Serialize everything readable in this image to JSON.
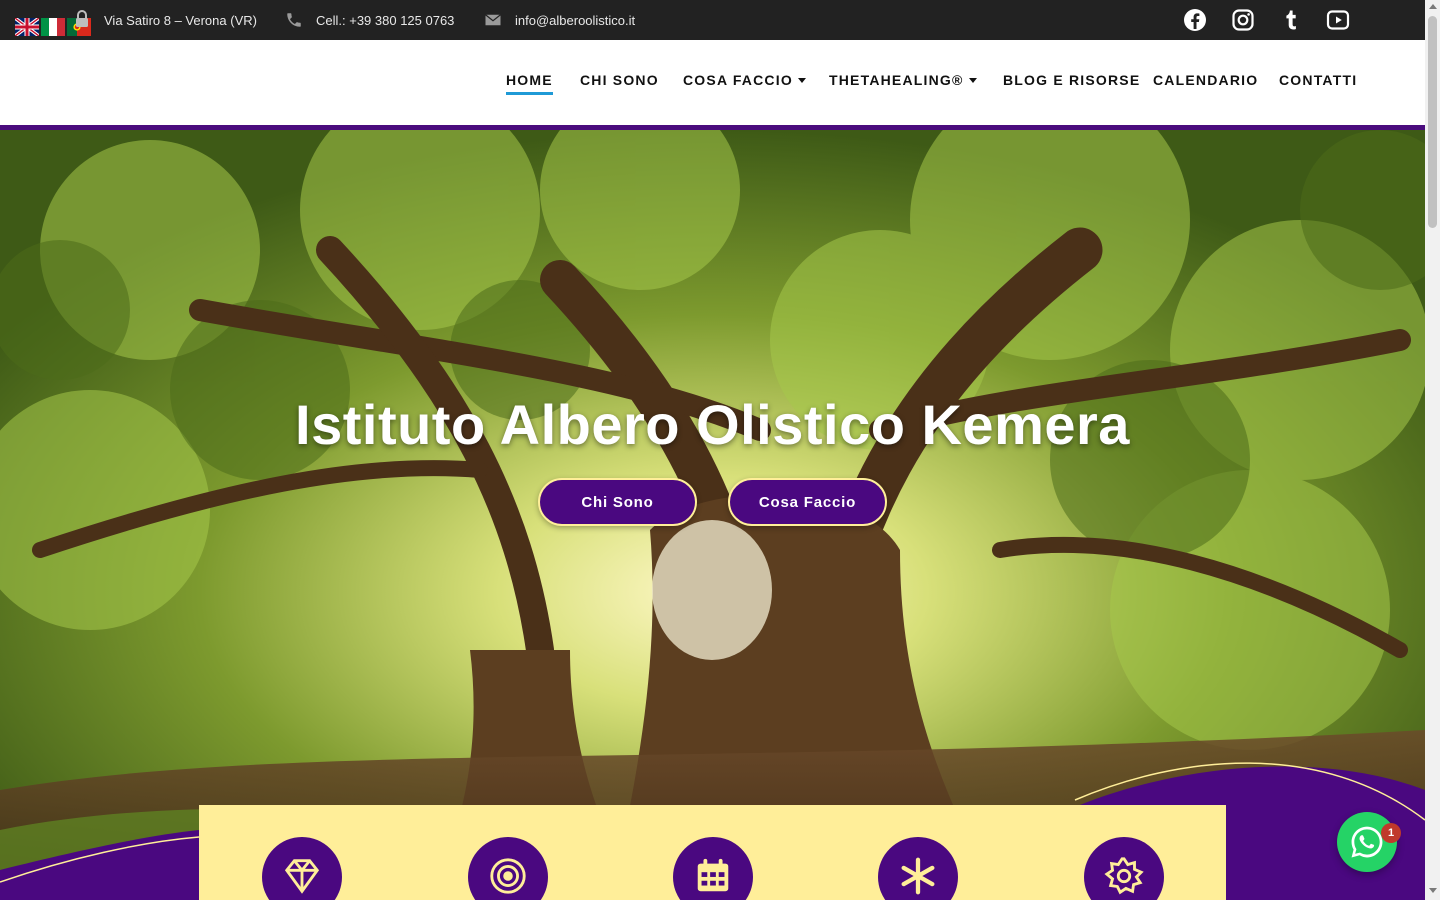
{
  "topbar": {
    "languages": [
      "English",
      "Italiano",
      "Português"
    ],
    "address": "Via Satiro 8 – Verona (VR)",
    "phone": "Cell.: +39 380 125 0763",
    "email": "info@alberoolistico.it",
    "social_icons": [
      "facebook-icon",
      "instagram-icon",
      "tumblr-icon",
      "youtube-icon"
    ]
  },
  "nav": {
    "items": [
      {
        "label": "HOME",
        "active": true,
        "dropdown": false
      },
      {
        "label": "CHI SONO",
        "active": false,
        "dropdown": false
      },
      {
        "label": "COSA FACCIO",
        "active": false,
        "dropdown": true
      },
      {
        "label": "THETAHEALING®",
        "active": false,
        "dropdown": true
      },
      {
        "label": "BLOG E RISORSE",
        "active": false,
        "dropdown": false
      },
      {
        "label": "CALENDARIO",
        "active": false,
        "dropdown": false
      },
      {
        "label": "CONTATTI",
        "active": false,
        "dropdown": false
      }
    ]
  },
  "hero": {
    "title": "Istituto Albero Olistico Kemera",
    "buttons": [
      {
        "label": "Chi Sono"
      },
      {
        "label": "Cosa Faccio"
      }
    ]
  },
  "features": {
    "icons": [
      "diamond-icon",
      "target-icon",
      "calendar-icon",
      "asterisk-icon",
      "gear-icon"
    ]
  },
  "whatsapp": {
    "badge": "1"
  },
  "colors": {
    "topbar": "#222222",
    "accent_purple": "#4a0880",
    "accent_yellow": "#ffee99",
    "active_underline": "#1f9ad6",
    "whatsapp": "#25d366"
  }
}
